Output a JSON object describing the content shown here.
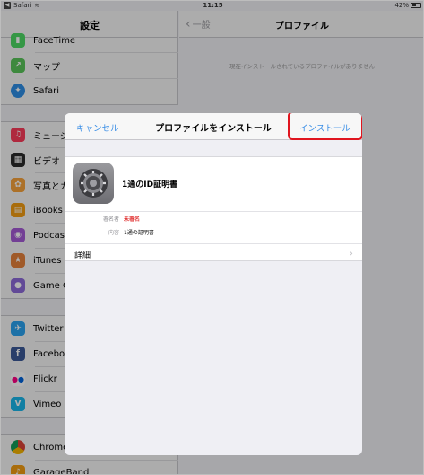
{
  "status_bar": {
    "back_app": "Safari",
    "time": "11:15",
    "battery": "42%"
  },
  "left_panel": {
    "title": "設定",
    "items": [
      {
        "label": "FaceTime",
        "icon": "facetime-icon",
        "color": "#4cd964"
      },
      {
        "label": "マップ",
        "icon": "maps-icon",
        "color": "#5ac45a"
      },
      {
        "label": "Safari",
        "icon": "safari-icon",
        "color": "#2f8fe6"
      },
      {
        "label": "ミュージ",
        "icon": "music-icon",
        "color": "#fb3b5a"
      },
      {
        "label": "ビデオ",
        "icon": "video-icon",
        "color": "#2b2b2b"
      },
      {
        "label": "写真とカ",
        "icon": "photos-icon",
        "color": "#f7a23b"
      },
      {
        "label": "iBooks",
        "icon": "ibooks-icon",
        "color": "#f39c12"
      },
      {
        "label": "Podcas",
        "icon": "podcasts-icon",
        "color": "#a55bd6"
      },
      {
        "label": "iTunes",
        "icon": "itunes-icon",
        "color": "#e6813c"
      },
      {
        "label": "Game C",
        "icon": "game-center-icon",
        "color": "#8d6ad8"
      },
      {
        "label": "Twitter",
        "icon": "twitter-icon",
        "color": "#2aa3ef"
      },
      {
        "label": "Facebo",
        "icon": "facebook-icon",
        "color": "#3b5998"
      },
      {
        "label": "Flickr",
        "icon": "flickr-icon",
        "color": "#ffffff"
      },
      {
        "label": "Vimeo",
        "icon": "vimeo-icon",
        "color": "#1ab7ea"
      },
      {
        "label": "Chrome",
        "icon": "chrome-icon",
        "color": "#ffffff"
      },
      {
        "label": "GarageBand",
        "icon": "garageband-icon",
        "color": "#f39c12"
      }
    ]
  },
  "right_panel": {
    "back_label": "一般",
    "title": "プロファイル",
    "empty_message": "現在インストールされているプロファイルがありません"
  },
  "modal": {
    "cancel_label": "キャンセル",
    "title": "プロファイルをインストール",
    "install_label": "インストール",
    "profile_name": "1通のID証明書",
    "signer_key": "署名者",
    "signer_value": "未署名",
    "contents_key": "内容",
    "contents_value": "1通の証明書",
    "details_label": "詳細"
  },
  "colors": {
    "accent": "#3a8ee6",
    "highlight": "#e0151f",
    "unsigned": "#e23b3b"
  }
}
